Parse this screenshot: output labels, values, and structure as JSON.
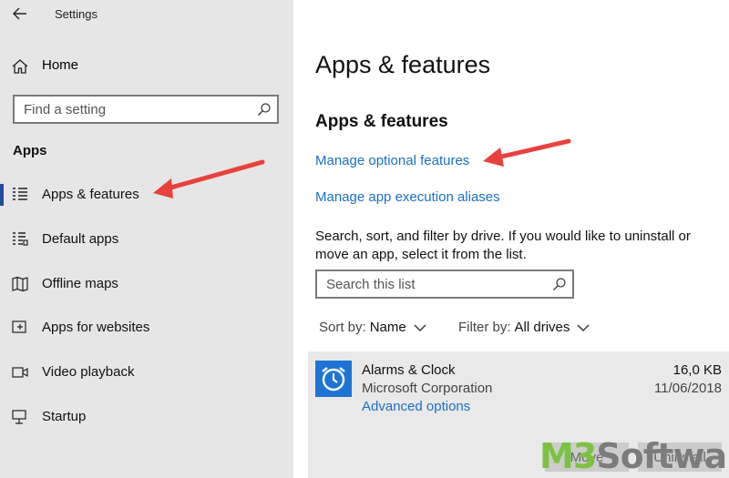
{
  "window": {
    "title": "Settings"
  },
  "sidebar": {
    "home_label": "Home",
    "search_placeholder": "Find a setting",
    "section_title": "Apps",
    "items": [
      {
        "label": "Apps & features",
        "icon": "list-icon",
        "active": true
      },
      {
        "label": "Default apps",
        "icon": "default-apps-icon",
        "active": false
      },
      {
        "label": "Offline maps",
        "icon": "map-icon",
        "active": false
      },
      {
        "label": "Apps for websites",
        "icon": "web-apps-icon",
        "active": false
      },
      {
        "label": "Video playback",
        "icon": "video-icon",
        "active": false
      },
      {
        "label": "Startup",
        "icon": "startup-icon",
        "active": false
      }
    ]
  },
  "main": {
    "page_title": "Apps & features",
    "section_title": "Apps & features",
    "link_optional_features": "Manage optional features",
    "link_execution_aliases": "Manage app execution aliases",
    "description": "Search, sort, and filter by drive. If you would like to uninstall or move an app, select it from the list.",
    "list_search_placeholder": "Search this list",
    "sort_label": "Sort by:",
    "sort_value": "Name",
    "filter_label": "Filter by:",
    "filter_value": "All drives",
    "apps": [
      {
        "name": "Alarms & Clock",
        "publisher": "Microsoft Corporation",
        "advanced_link": "Advanced options",
        "size": "16,0 KB",
        "date": "11/06/2018",
        "move_label": "Move",
        "uninstall_label": "Uninstall"
      }
    ]
  },
  "watermark": {
    "part1": "M3",
    "part2": "Software"
  },
  "colors": {
    "accent": "#1b70c6",
    "sidebar_bg": "#e6e6e6",
    "arrow": "#e8413b",
    "app_icon_bg": "#1e74d4",
    "watermark_green": "#7cc242"
  }
}
